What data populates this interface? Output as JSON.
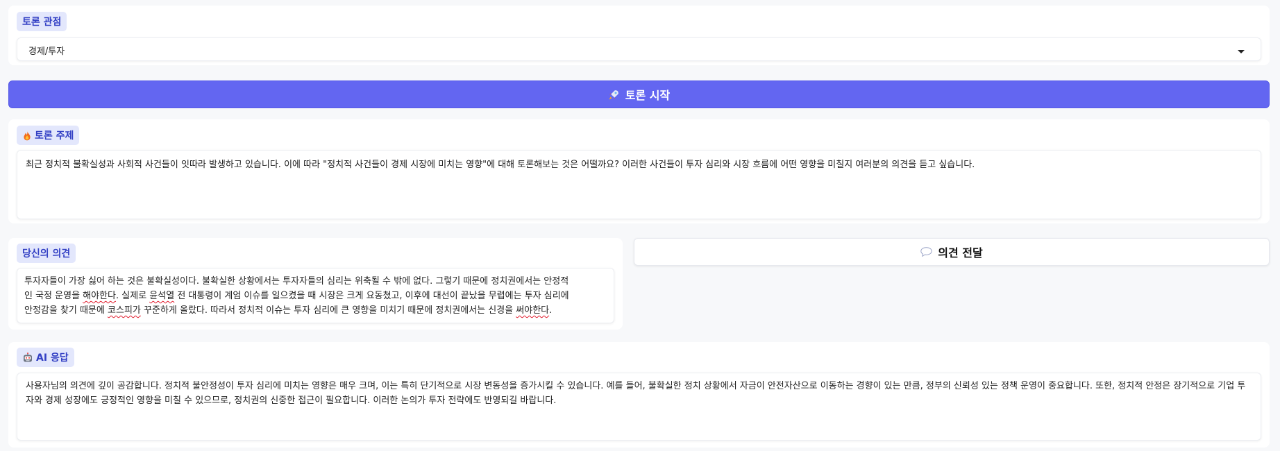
{
  "perspective": {
    "label": "토론 관점",
    "selected": "경제/투자"
  },
  "start_button": {
    "label": "토론 시작",
    "icon": "rocket-icon"
  },
  "topic": {
    "label": "토론 주제",
    "icon": "fire-icon",
    "text": "최근 정치적 불확실성과 사회적 사건들이 잇따라 발생하고 있습니다. 이에 따라 \"정치적 사건들이 경제 시장에 미치는 영향\"에 대해 토론해보는 것은 어떨까요? 이러한 사건들이 투자 심리와 시장 흐름에 어떤 영향을 미칠지 여러분의 의견을 듣고 싶습니다."
  },
  "opinion": {
    "label": "당신의 의견",
    "segments": [
      {
        "text": "투자자들이 가장 싫어 하는 것은 불확실성이다. 불확실한 상황에서는 투자자들의 심리는 위축될 수 밖에 없다. 그렇기 때문에 정치권에서는 안정적",
        "break": true
      },
      {
        "text": "인 국정 운영을 ",
        "break": false
      },
      {
        "text": "해야한다",
        "spell": true
      },
      {
        "text": ". 실제로 ",
        "break": false
      },
      {
        "text": "윤석열",
        "spell": true
      },
      {
        "text": " 전 대통령이 계엄 이슈를 일으켰을 때 시장은 크게 요동쳤고, 이후에 대선이 끝났을 무렵에는 투자 심리에",
        "break": true
      },
      {
        "text": "안정감을 찾기 때문에 ",
        "break": false
      },
      {
        "text": "코스피가",
        "spell": true
      },
      {
        "text": " 꾸준하게 올랐다. 따라서 정치적 이슈는 투자 심리에 큰 영향을 미치기 때문에 정치권에서는 신경을 ",
        "break": false
      },
      {
        "text": "써야한다",
        "spell": true
      },
      {
        "text": ".",
        "break": false
      }
    ]
  },
  "send_button": {
    "label": "의견 전달",
    "icon": "speech-bubble-icon"
  },
  "ai_response": {
    "label": "AI 응답",
    "icon": "robot-icon",
    "text": "사용자님의 의견에 깊이 공감합니다. 정치적 불안정성이 투자 심리에 미치는 영향은 매우 크며, 이는 특히 단기적으로 시장 변동성을 증가시킬 수 있습니다. 예를 들어, 불확실한 정치 상황에서 자금이 안전자산으로 이동하는 경향이 있는 만큼, 정부의 신뢰성 있는 정책 운영이 중요합니다. 또한, 정치적 안정은 장기적으로 기업 투자와 경제 성장에도 긍정적인 영향을 미칠 수 있으므로, 정치권의 신중한 접근이 필요합니다. 이러한 논의가 투자 전략에도 반영되길 바랍니다."
  },
  "colors": {
    "accent": "#6366f1",
    "tag_bg": "#e3e7fc",
    "tag_text": "#3340c4",
    "page_bg": "#f7f8fa",
    "spell_underline": "#e11d2e"
  }
}
